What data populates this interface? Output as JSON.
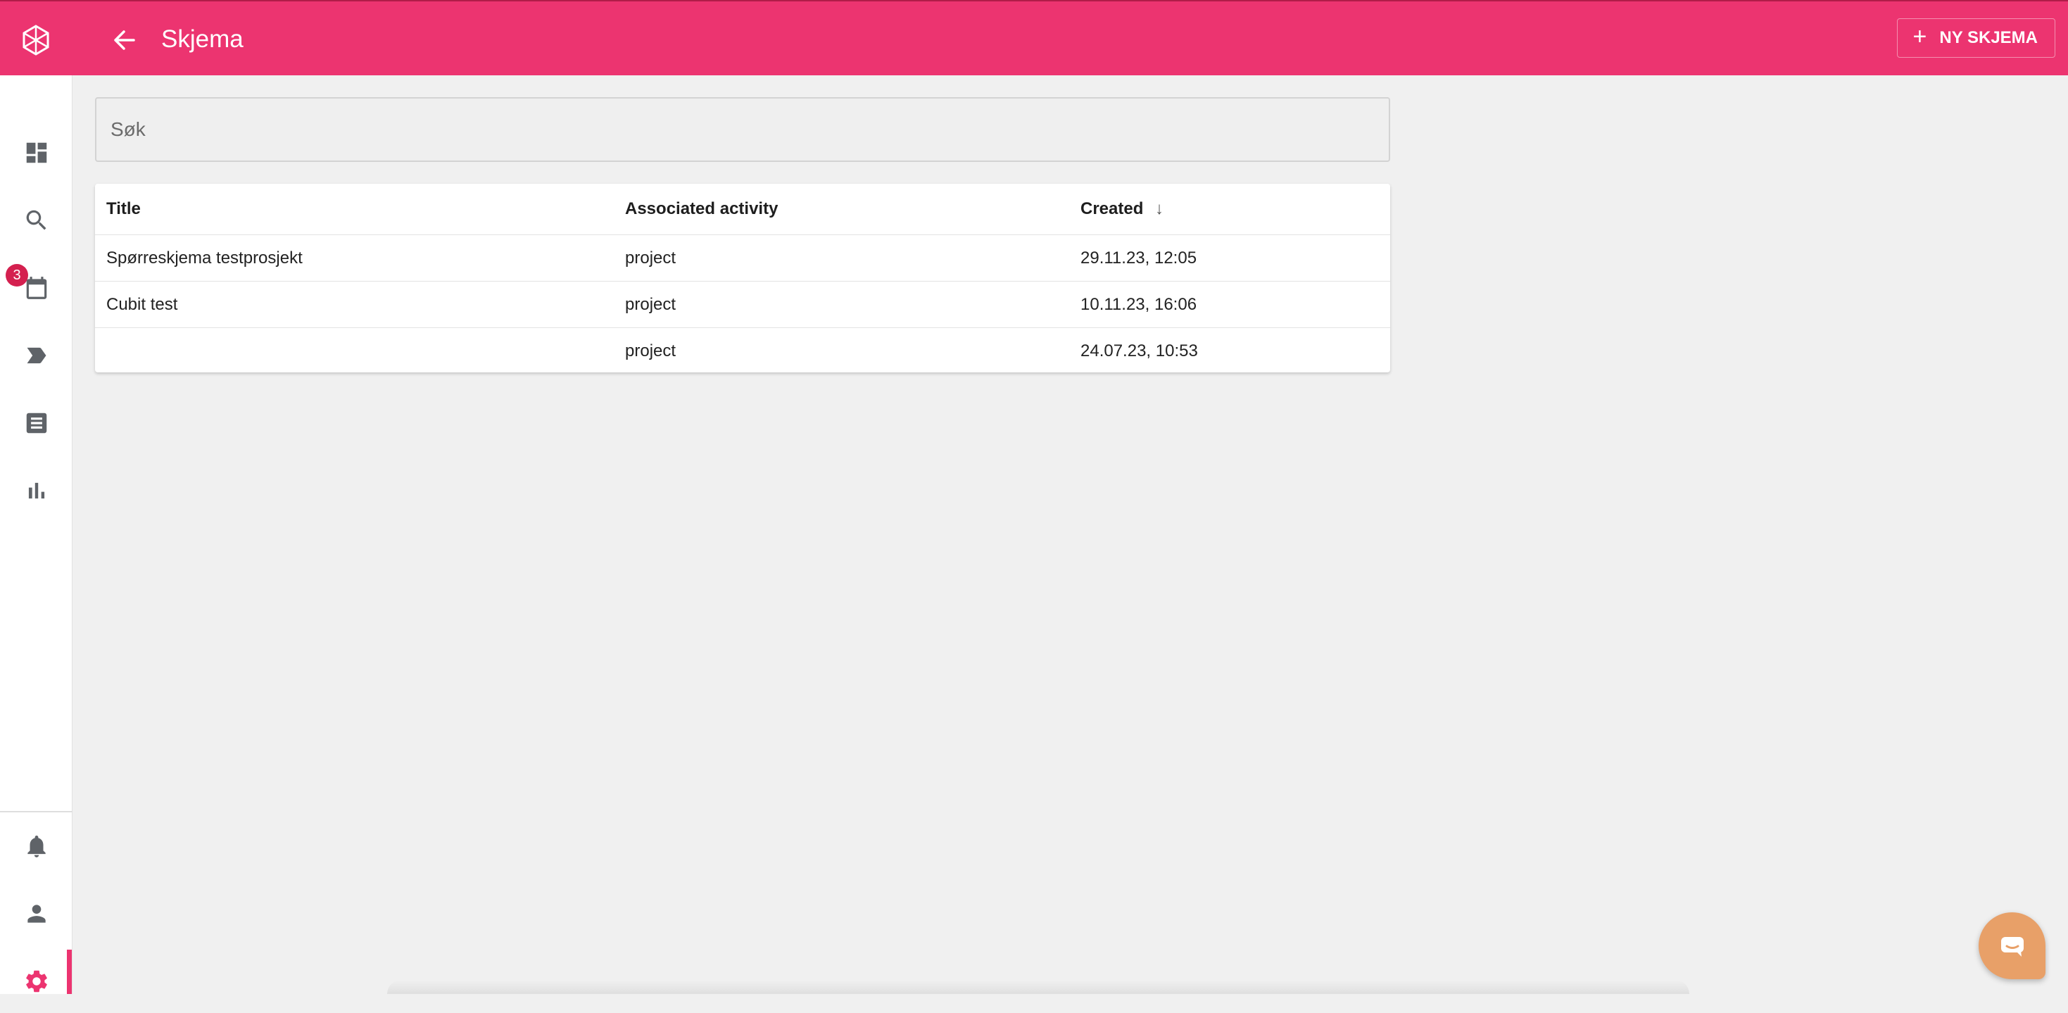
{
  "colors": {
    "accent": "#ec3470",
    "chat_button": "#e8a068",
    "badge": "#d4204f"
  },
  "header": {
    "title": "Skjema",
    "back_icon": "arrow-left-icon",
    "logo_icon": "app-logo-icon",
    "new_button_label": "NY SKJEMA"
  },
  "sidebar": {
    "items": [
      {
        "name": "dashboard",
        "icon": "dashboard-icon"
      },
      {
        "name": "search",
        "icon": "search-icon"
      },
      {
        "name": "calendar",
        "icon": "calendar-icon",
        "badge": "3"
      },
      {
        "name": "tags",
        "icon": "label-icon"
      },
      {
        "name": "documents",
        "icon": "document-list-icon"
      },
      {
        "name": "reports",
        "icon": "bar-chart-icon"
      }
    ],
    "bottom_items": [
      {
        "name": "notifications",
        "icon": "bell-icon"
      },
      {
        "name": "profile",
        "icon": "person-icon"
      },
      {
        "name": "settings",
        "icon": "gear-icon",
        "active": true
      }
    ]
  },
  "search": {
    "placeholder": "Søk",
    "value": ""
  },
  "table": {
    "columns": [
      "Title",
      "Associated activity",
      "Created"
    ],
    "sort_indicator": "↓",
    "rows": [
      {
        "title": "Spørreskjema testprosjekt",
        "activity": "project",
        "created": "29.11.23, 12:05"
      },
      {
        "title": "Cubit test",
        "activity": "project",
        "created": "10.11.23, 16:06"
      },
      {
        "title": "",
        "activity": "project",
        "created": "24.07.23, 10:53"
      }
    ]
  }
}
